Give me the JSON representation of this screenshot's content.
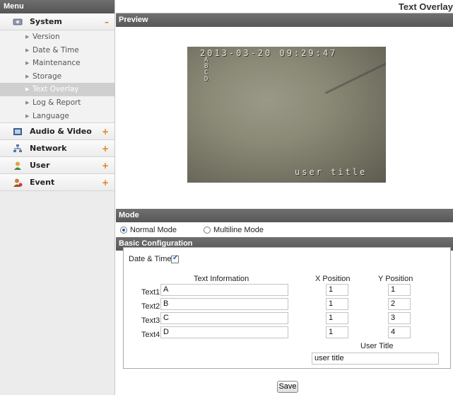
{
  "sidebar": {
    "header": "Menu",
    "categories": [
      {
        "label": "System",
        "sign": "–"
      },
      {
        "label": "Audio & Video",
        "sign": "+"
      },
      {
        "label": "Network",
        "sign": "+"
      },
      {
        "label": "User",
        "sign": "+"
      },
      {
        "label": "Event",
        "sign": "+"
      }
    ],
    "system_items": [
      "Version",
      "Date & Time",
      "Maintenance",
      "Storage",
      "Text Overlay",
      "Log & Report",
      "Language"
    ]
  },
  "page": {
    "title": "Text Overlay",
    "preview_section": "Preview",
    "mode_section": "Mode",
    "basic_section": "Basic Configuration"
  },
  "video": {
    "timestamp": "2013-03-20 09:29:47",
    "lines": [
      "A",
      "B",
      "C",
      "D"
    ],
    "title_overlay": "user title"
  },
  "mode": {
    "options": [
      "Normal Mode",
      "Multiline Mode"
    ],
    "selected": "Normal Mode"
  },
  "config": {
    "date_time_label": "Date & Time",
    "date_time_checked": true,
    "col_text": "Text Information",
    "col_x": "X Position",
    "col_y": "Y Position",
    "rows": [
      {
        "label": "Text1:",
        "text": "A",
        "x": "1",
        "y": "1"
      },
      {
        "label": "Text2:",
        "text": "B",
        "x": "1",
        "y": "2"
      },
      {
        "label": "Text3:",
        "text": "C",
        "x": "1",
        "y": "3"
      },
      {
        "label": "Text4:",
        "text": "D",
        "x": "1",
        "y": "4"
      }
    ],
    "user_title_label": "User Title",
    "user_title_value": "user title"
  },
  "buttons": {
    "save": "Save"
  },
  "colors": {
    "accent_sign": "#e08020",
    "section_header": "#5e5e5e"
  }
}
